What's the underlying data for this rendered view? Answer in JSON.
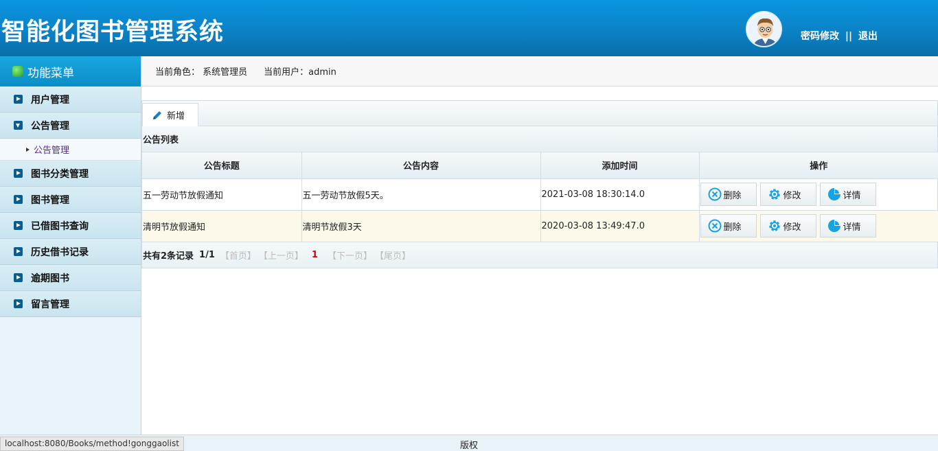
{
  "header": {
    "title": "智能化图书管理系统",
    "links": {
      "change_password": "密码修改",
      "separator": "||",
      "logout": "退出"
    }
  },
  "sidebar": {
    "title": "功能菜单",
    "items": [
      {
        "label": "用户管理"
      },
      {
        "label": "公告管理",
        "expanded": true,
        "sub": "公告管理"
      },
      {
        "label": "图书分类管理"
      },
      {
        "label": "图书管理"
      },
      {
        "label": "已借图书查询"
      },
      {
        "label": "历史借书记录"
      },
      {
        "label": "逾期图书"
      },
      {
        "label": "留言管理"
      }
    ]
  },
  "infobar": {
    "role": "当前角色： 系统管理员",
    "user": "当前用户：admin"
  },
  "toolbar": {
    "add_label": "新增"
  },
  "list": {
    "title": "公告列表",
    "columns": [
      "公告标题",
      "公告内容",
      "添加时间",
      "操作"
    ],
    "rows": [
      {
        "title": "五一劳动节放假通知",
        "content": "五一劳动节放假5天。",
        "time": "2021-03-08 18:30:14.0"
      },
      {
        "title": "清明节放假通知",
        "content": "清明节放假3天",
        "time": "2020-03-08 13:49:47.0"
      }
    ],
    "actions": {
      "delete": "删除",
      "edit": "修改",
      "detail": "详情"
    }
  },
  "pager": {
    "total": "共有2条记录",
    "page": "1/1",
    "first": "【首页】",
    "prev": "【上一页】",
    "current": "1",
    "next": "【下一页】",
    "last": "【尾页】"
  },
  "footer": {
    "copyright": "版权"
  },
  "statusbar": {
    "url": "localhost:8080/Books/method!gonggaolist"
  },
  "colors": {
    "header": "#0a82c6",
    "accent": "#0b8ec8",
    "icon": "#17a3e0"
  }
}
